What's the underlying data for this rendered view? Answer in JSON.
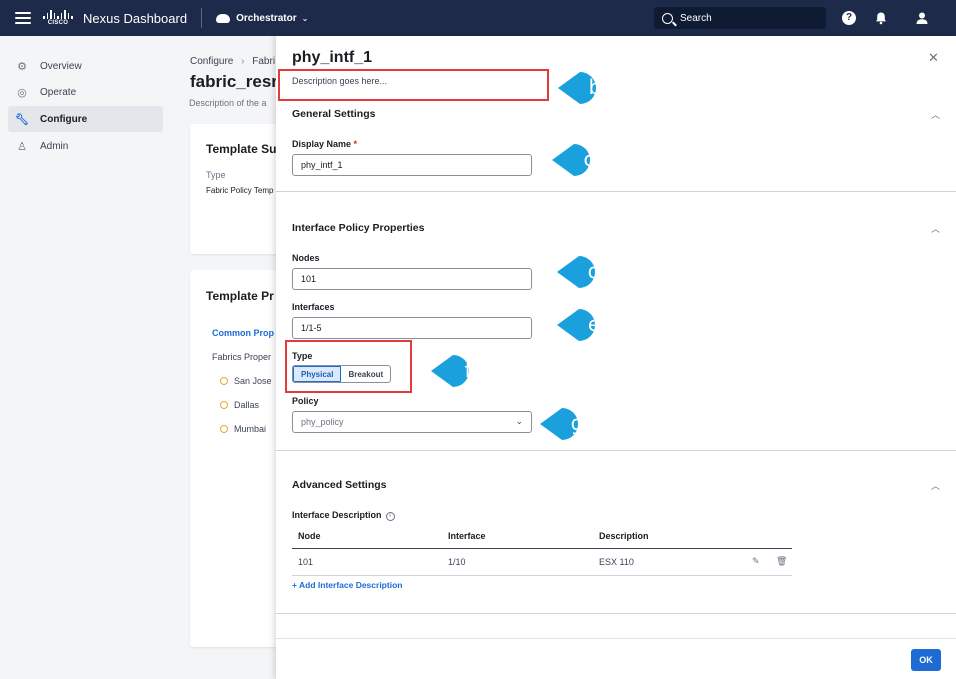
{
  "topbar": {
    "cisco_text": "CISCO",
    "app_title": "Nexus Dashboard",
    "service": "Orchestrator",
    "search_placeholder": "Search",
    "help": "?"
  },
  "sidenav": {
    "items": [
      {
        "label": "Overview",
        "icon": "overview-icon"
      },
      {
        "label": "Operate",
        "icon": "operate-icon"
      },
      {
        "label": "Configure",
        "icon": "wrench-icon",
        "active": true
      },
      {
        "label": "Admin",
        "icon": "admin-icon"
      }
    ]
  },
  "background": {
    "breadcrumb_root": "Configure",
    "breadcrumb_next": "Fabri",
    "title": "fabric_resr",
    "description": "Description of the a",
    "summary_title": "Template Su",
    "type_label": "Type",
    "type_value": "Fabric Policy Temp",
    "props_title": "Template Pr",
    "common_props": "Common Prop",
    "fabrics_props": "Fabrics Proper",
    "fabrics": [
      "San Jose",
      "Dallas",
      "Mumbai"
    ]
  },
  "drawer": {
    "title": "phy_intf_1",
    "description": "Description goes here...",
    "general": {
      "heading": "General Settings",
      "display_name_label": "Display Name",
      "required_mark": "*",
      "display_name_value": "phy_intf_1"
    },
    "policy_props": {
      "heading": "Interface Policy Properties",
      "nodes_label": "Nodes",
      "nodes_value": "101",
      "interfaces_label": "Interfaces",
      "interfaces_value": "1/1-5",
      "type_label": "Type",
      "type_options": [
        "Physical",
        "Breakout"
      ],
      "type_selected": "Physical",
      "policy_label": "Policy",
      "policy_value": "phy_policy"
    },
    "advanced": {
      "heading": "Advanced Settings",
      "iface_desc_label": "Interface Description",
      "columns": [
        "Node",
        "Interface",
        "Description"
      ],
      "rows": [
        {
          "node": "101",
          "interface": "1/10",
          "description": "ESX 110"
        }
      ],
      "add_link": "Add Interface Description"
    },
    "ok_label": "OK"
  },
  "callouts": [
    "b",
    "c",
    "d",
    "e",
    "f",
    "g"
  ],
  "colors": {
    "topbar": "#1d2a4a",
    "accent": "#1e6bd6",
    "callout": "#1aa1dd",
    "highlight": "#e23b3b"
  }
}
